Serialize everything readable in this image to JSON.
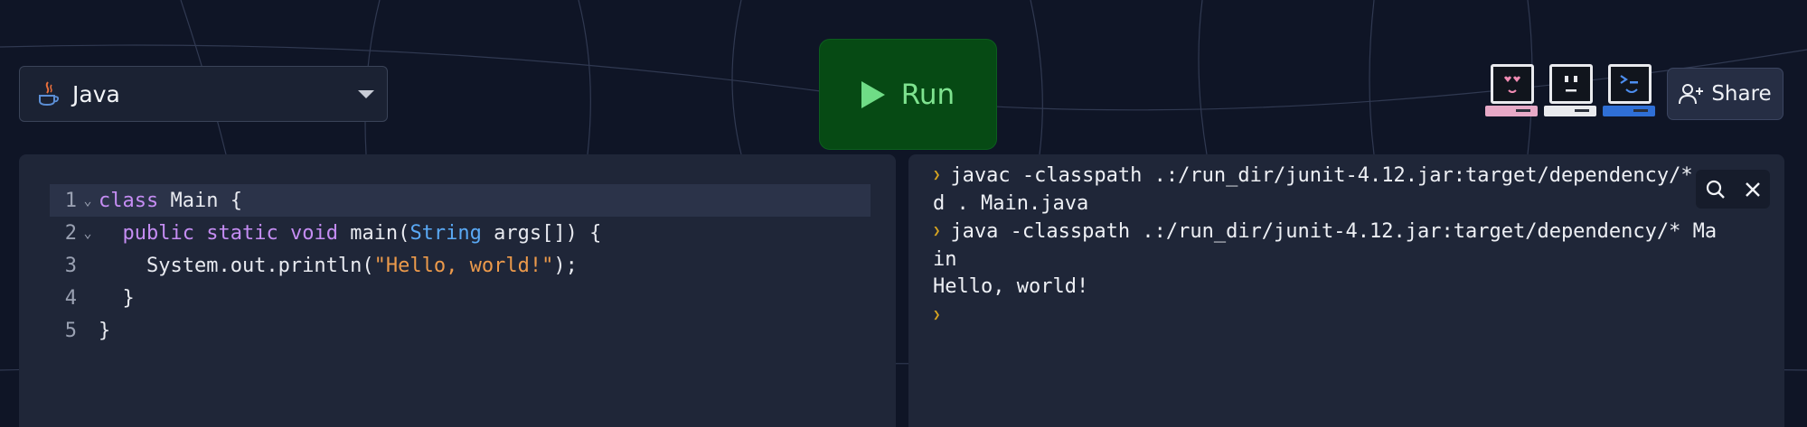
{
  "language_selector": {
    "selected": "Java"
  },
  "run_button": {
    "label": "Run"
  },
  "share_button": {
    "label": "Share"
  },
  "editor": {
    "lines": [
      {
        "number": "1"
      },
      {
        "number": "2"
      },
      {
        "number": "3"
      },
      {
        "number": "4"
      },
      {
        "number": "5"
      }
    ],
    "code": {
      "l1_kw": "class",
      "l1_rest": " Main {",
      "l2_indent": "  ",
      "l2_kw1": "public",
      "l2_kw2": "static",
      "l2_kw3": "void",
      "l2_mid": " main(",
      "l2_type": "String",
      "l2_end": " args[]) {",
      "l3_pre": "    System.out.println(",
      "l3_str": "\"Hello, world!\"",
      "l3_end": ");",
      "l4": "  }",
      "l5": "}"
    }
  },
  "console": {
    "lines": [
      "javac -classpath .:/run_dir/junit-4.12.jar:target/dependency/*",
      "d . Main.java",
      "java -classpath .:/run_dir/junit-4.12.jar:target/dependency/* Ma",
      "in",
      "Hello, world!"
    ]
  },
  "colors": {
    "background": "#0f1526",
    "panel": "#1f2638",
    "run": "#064a14",
    "keyword": "#c58df3",
    "type": "#5aa9f5",
    "string": "#ec9a4b",
    "prompt": "#d6a421"
  },
  "icons": {
    "language": "java-icon",
    "dropdown": "chevron-down-icon",
    "run": "play-icon",
    "share": "add-user-icon",
    "console_search": "search-icon",
    "console_close": "close-icon",
    "avatars": [
      "love-face-icon",
      "neutral-face-icon",
      "terminal-face-icon"
    ]
  }
}
